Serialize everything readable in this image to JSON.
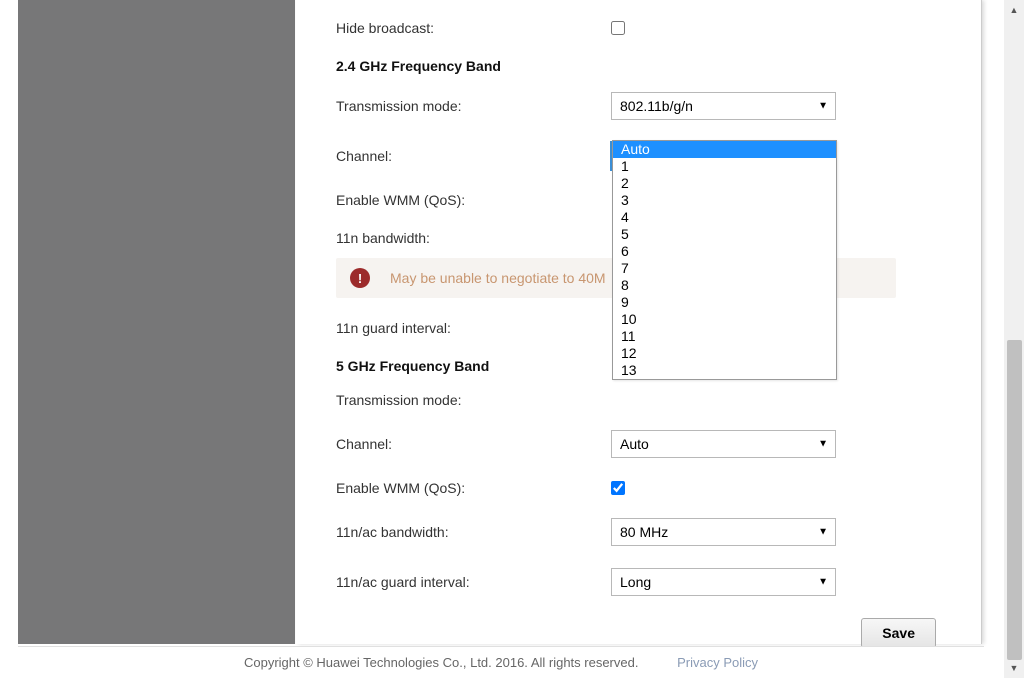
{
  "form": {
    "hide_broadcast_label": "Hide broadcast:",
    "hide_broadcast_checked": false,
    "band24_header": "2.4 GHz Frequency Band",
    "transmission_mode_label": "Transmission mode:",
    "transmission_mode_24_value": "802.11b/g/n",
    "channel_label": "Channel:",
    "channel_24_value": "Auto",
    "enable_wmm_label": "Enable WMM (QoS):",
    "bandwidth_11n_label": "11n bandwidth:",
    "alert_text": "May be unable to negotiate to 40M",
    "guard_interval_11n_label": "11n guard interval:",
    "band5_header": "5 GHz Frequency Band",
    "transmission_mode_5_label": "Transmission mode:",
    "channel_5_label": "Channel:",
    "channel_5_value": "Auto",
    "enable_wmm_5_label": "Enable WMM (QoS):",
    "enable_wmm_5_checked": true,
    "bandwidth_11nac_label": "11n/ac bandwidth:",
    "bandwidth_11nac_value": "80 MHz",
    "guard_interval_11nac_label": "11n/ac guard interval:",
    "guard_interval_11nac_value": "Long",
    "save_label": "Save"
  },
  "dropdown": {
    "options": [
      "Auto",
      "1",
      "2",
      "3",
      "4",
      "5",
      "6",
      "7",
      "8",
      "9",
      "10",
      "11",
      "12",
      "13"
    ],
    "selected": "Auto"
  },
  "footer": {
    "copyright": "Copyright © Huawei Technologies Co., Ltd. 2016. All rights reserved.",
    "privacy": "Privacy Policy"
  }
}
